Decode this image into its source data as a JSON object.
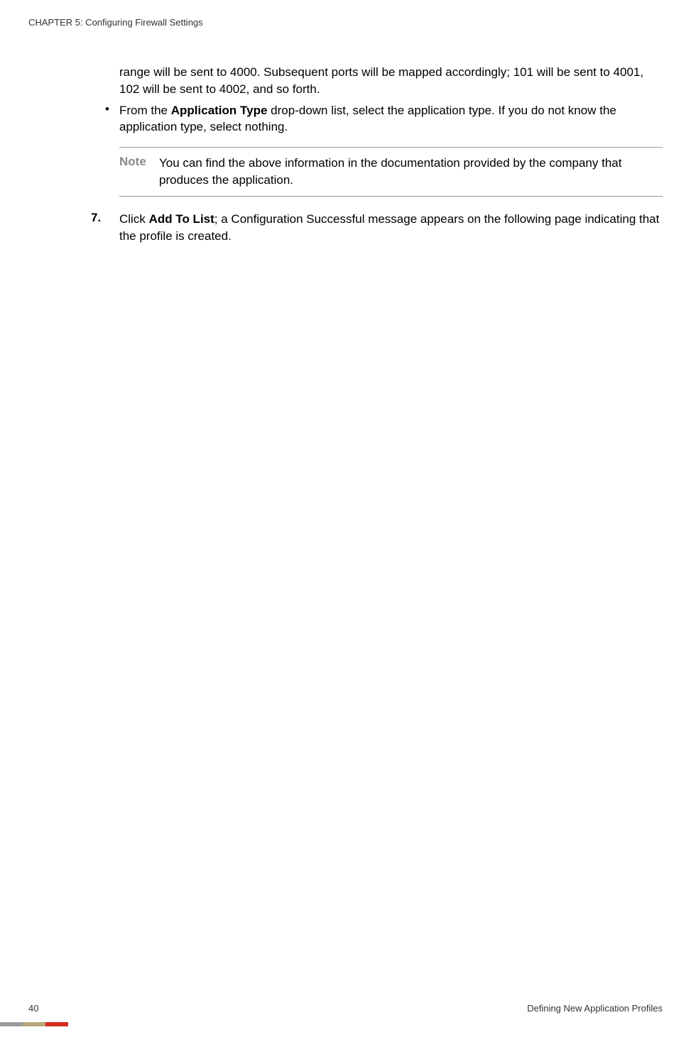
{
  "header": {
    "chapter": "CHAPTER 5: Configuring Firewall Settings"
  },
  "body": {
    "continuation": "range will be sent to 4000. Subsequent ports will be mapped accordingly; 101 will be sent to 4001, 102 will be sent to 4002, and so forth.",
    "bullet": {
      "prefix": "From the ",
      "bold1": "Application Type",
      "suffix": " drop-down list, select the application type. If you do not know the application type, select nothing."
    },
    "note": {
      "label": "Note",
      "text": "You can find the above information in the documentation provided by the company that produces the application."
    },
    "step": {
      "number": "7.",
      "prefix": "Click ",
      "bold1": "Add To List",
      "suffix": "; a Configuration Successful message appears on the following page indicating that the profile is created."
    }
  },
  "footer": {
    "page": "40",
    "section": "Defining New Application Profiles"
  }
}
